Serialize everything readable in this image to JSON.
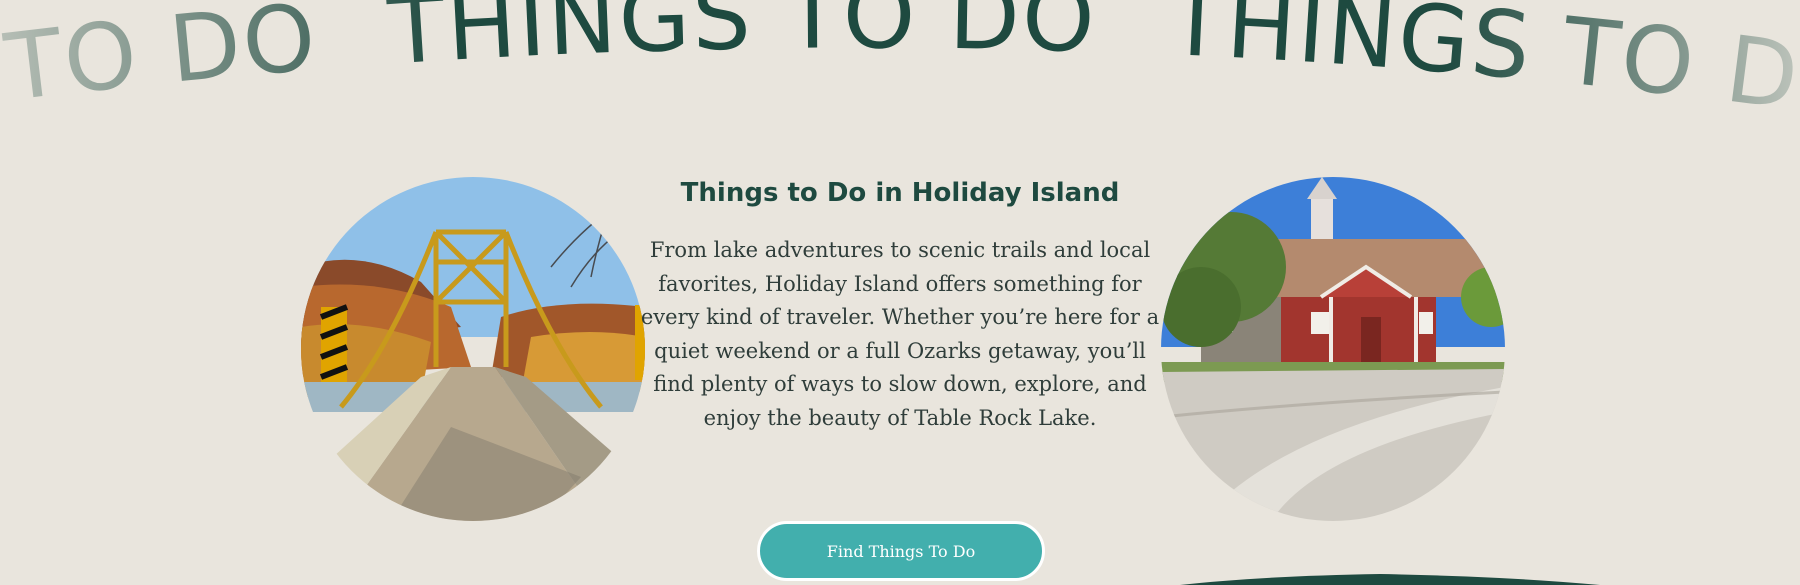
{
  "marquee": {
    "words": [
      "TO DO",
      "THINGS TO DO",
      "THINGS TO D"
    ],
    "color": "#1e4a40"
  },
  "section": {
    "heading": "Things to Do in Holiday Island",
    "body": "From lake adventures to scenic trails and local favorites, Holiday Island offers something for every kind of traveler. Whether you’re here for a quiet weekend or a full Ozarks getaway, you’ll find plenty of ways to slow down, explore, and enjoy the beauty of Table Rock Lake.",
    "cta_label": "Find Things To Do"
  },
  "colors": {
    "background": "#e9e5dd",
    "heading": "#1e4a40",
    "button": "#42afad",
    "button_text": "#ffffff"
  }
}
